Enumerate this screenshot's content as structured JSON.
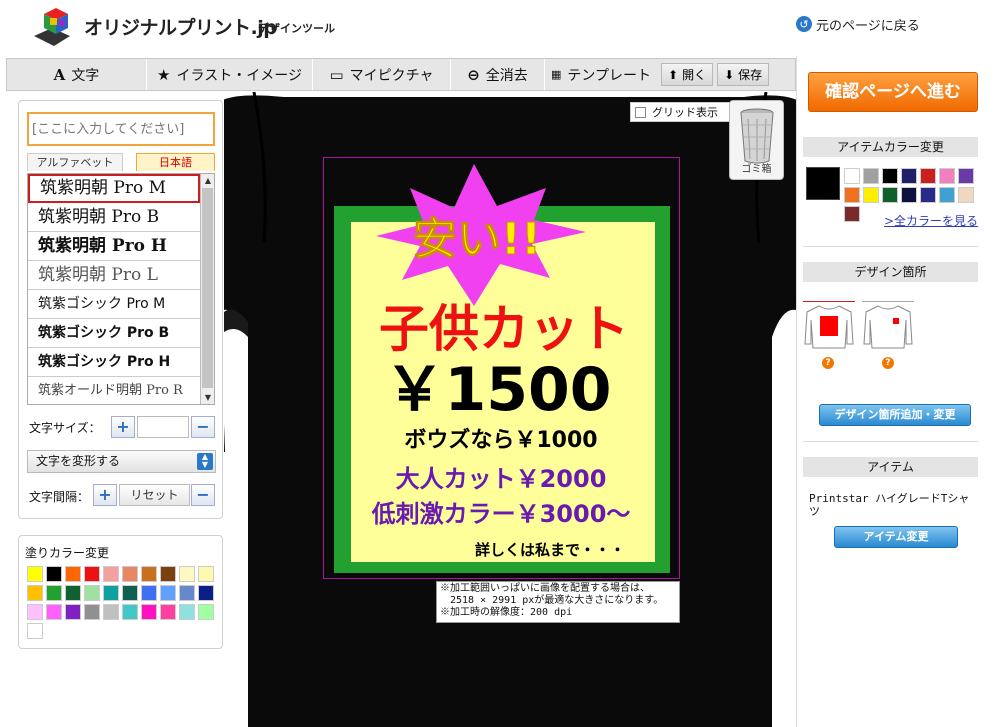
{
  "header": {
    "logo": "オリジナルプリント.jp",
    "subtitle": "デザインツール",
    "back_link": "元のページに戻る"
  },
  "toolbar": {
    "text_label": "文字",
    "illust_label": "イラスト・イメージ",
    "mypicture_label": "マイピクチャ",
    "clear_label": "全消去",
    "template_label": "テンプレート",
    "open_label": "開く",
    "save_label": "保存"
  },
  "left_panel": {
    "text_input_placeholder": "[ここに入力してください]",
    "tab_alphabet": "アルファベット",
    "tab_japanese": "日本語",
    "fonts": [
      "筑紫明朝 Pro M",
      "筑紫明朝 Pro B",
      "筑紫明朝 Pro H",
      "筑紫明朝 Pro L",
      "筑紫ゴシック Pro M",
      "筑紫ゴシック Pro B",
      "筑紫ゴシック Pro H",
      "筑紫オールド明朝 Pro R"
    ],
    "selected_font": "筑紫明朝 Pro M",
    "size_label": "文字サイズ：",
    "transform_label": "文字を変形する",
    "spacing_label": "文字間隔：",
    "reset_label": "リセット",
    "fill_title": "塗りカラー変更",
    "fill_colors": [
      "#ffff00",
      "#000000",
      "#ff6600",
      "#ee1111",
      "#f4a0a0",
      "#e88860",
      "#c87020",
      "#7a4010",
      "#fff8c0",
      "#fff8b0",
      "#ffc000",
      "#22a030",
      "#106030",
      "#a0e0a0",
      "#10a0a0",
      "#106050",
      "#4070f0",
      "#60a0ff",
      "#6688cc",
      "#0a1f88",
      "#ffc0ff",
      "#ff60ff",
      "#8020c0",
      "#909090",
      "#c0c0c0",
      "#40c8c8",
      "#ff10c0",
      "#ff40a0",
      "#90e0e0",
      "#a0ffa0",
      "#ffffff"
    ]
  },
  "canvas": {
    "grid_label": "グリッド表示",
    "trash_label": "ゴミ箱",
    "print_note": [
      "※加工範囲いっぱいに画像を配置する場合は、",
      "　2518 × 2991 pxが最適な大きさになります。",
      "※加工時の解像度：200 dpi"
    ],
    "design": {
      "burst_text": "安い!!",
      "line1": "子供カット",
      "line2": "￥1500",
      "line3": "ボウズなら￥1000",
      "line4": "大人カット￥2000",
      "line5": "低刺激カラー￥3000〜",
      "line6": "詳しくは私まで・・・",
      "colors": {
        "frame": "#22a030",
        "panel": "#ffff99",
        "burst": "#f040f0",
        "burst_text": "#ffee00",
        "line1": "#ee1111",
        "line2": "#000000",
        "line4": "#6a1ab0"
      }
    }
  },
  "right_panel": {
    "confirm_label": "確認ページへ進む",
    "item_color_title": "アイテムカラー変更",
    "item_colors": [
      "#ffffff",
      "#a0a0a0",
      "#000000",
      "#20206a",
      "#cc1e1e",
      "#f080c0",
      "#6a3aa8",
      "#f07020",
      "#ffee00",
      "#10602a",
      "#101040",
      "#2a2a8a",
      "#40a0d0",
      "#f0d8c0",
      "#7a2a2a"
    ],
    "all_colors_link": ">全カラーを見る",
    "design_loc_title": "デザイン箇所",
    "add_loc_btn": "デザイン箇所追加・変更",
    "item_title": "アイテム",
    "item_name": "Printstar ハイグレードTシャツ",
    "change_item_btn": "アイテム変更"
  }
}
